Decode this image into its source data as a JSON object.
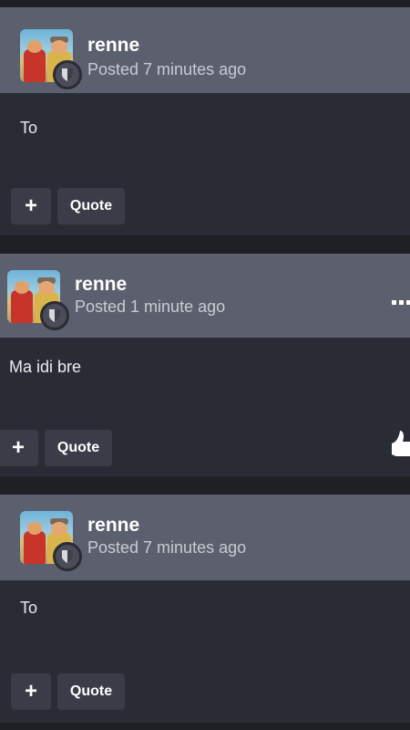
{
  "posts": [
    {
      "username": "renne",
      "posted": "Posted 7 minutes ago",
      "content": "To",
      "add_label": "+",
      "quote_label": "Quote"
    },
    {
      "username": "renne",
      "posted": "Posted 1 minute ago",
      "content": "Ma idi bre",
      "add_label": "+",
      "quote_label": "Quote",
      "more_icon": "ellipsis-icon",
      "like_icon": "thumbs-up-icon"
    },
    {
      "username": "renne",
      "posted": "Posted 7 minutes ago",
      "content": "To",
      "add_label": "+",
      "quote_label": "Quote"
    }
  ],
  "colors": {
    "page_background": "#1f2025",
    "post_background": "#2a2c35",
    "header_background": "#5c5f6e",
    "button_background": "#3a3c47"
  }
}
